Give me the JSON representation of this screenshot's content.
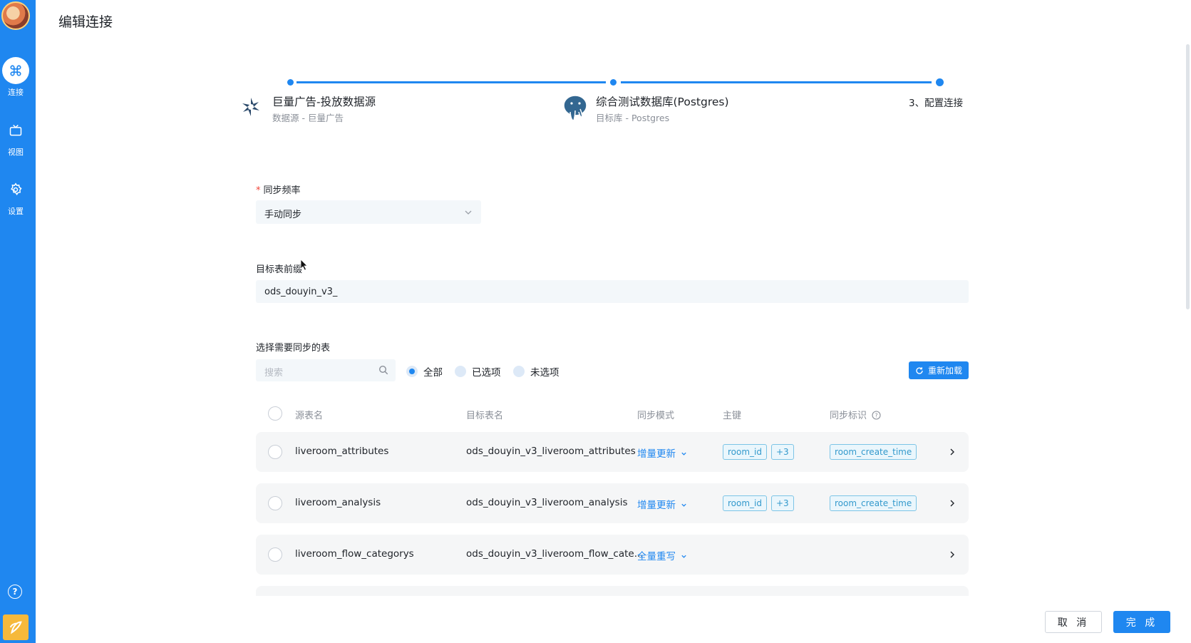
{
  "page_title": "编辑连接",
  "sidebar": {
    "items": [
      {
        "label": "连接",
        "icon": "command-icon"
      },
      {
        "label": "视图",
        "icon": "tv-icon"
      },
      {
        "label": "设置",
        "icon": "gear-icon"
      }
    ]
  },
  "steps": {
    "step1": {
      "title": "巨量广告-投放数据源",
      "sub": "数据源 - 巨量广告"
    },
    "step2": {
      "title": "综合测试数据库(Postgres)",
      "sub": "目标库 - Postgres"
    },
    "step3": {
      "title": "3、配置连接"
    }
  },
  "form": {
    "sync_freq_label": "同步频率",
    "sync_freq_value": "手动同步",
    "prefix_label": "目标表前缀",
    "prefix_value": "ods_douyin_v3_",
    "tables_label": "选择需要同步的表",
    "search_placeholder": "搜索",
    "filter_all": "全部",
    "filter_selected": "已选项",
    "filter_unselected": "未选项",
    "reload_label": "重新加载"
  },
  "table": {
    "headers": {
      "source": "源表名",
      "target": "目标表名",
      "mode": "同步模式",
      "pk": "主键",
      "flag": "同步标识"
    },
    "rows": [
      {
        "source": "liveroom_attributes",
        "target": "ods_douyin_v3_liveroom_attributes",
        "mode": "增量更新",
        "pk": "room_id",
        "pk_more": "+3",
        "flag": "room_create_time"
      },
      {
        "source": "liveroom_analysis",
        "target": "ods_douyin_v3_liveroom_analysis",
        "mode": "增量更新",
        "pk": "room_id",
        "pk_more": "+3",
        "flag": "room_create_time"
      },
      {
        "source": "liveroom_flow_categorys",
        "target": "ods_douyin_v3_liveroom_flow_cate...",
        "mode": "全量重写"
      }
    ]
  },
  "footer": {
    "cancel": "取 消",
    "done": "完 成"
  },
  "colors": {
    "primary": "#1f87f0",
    "tag_border": "#7cc4e6"
  }
}
